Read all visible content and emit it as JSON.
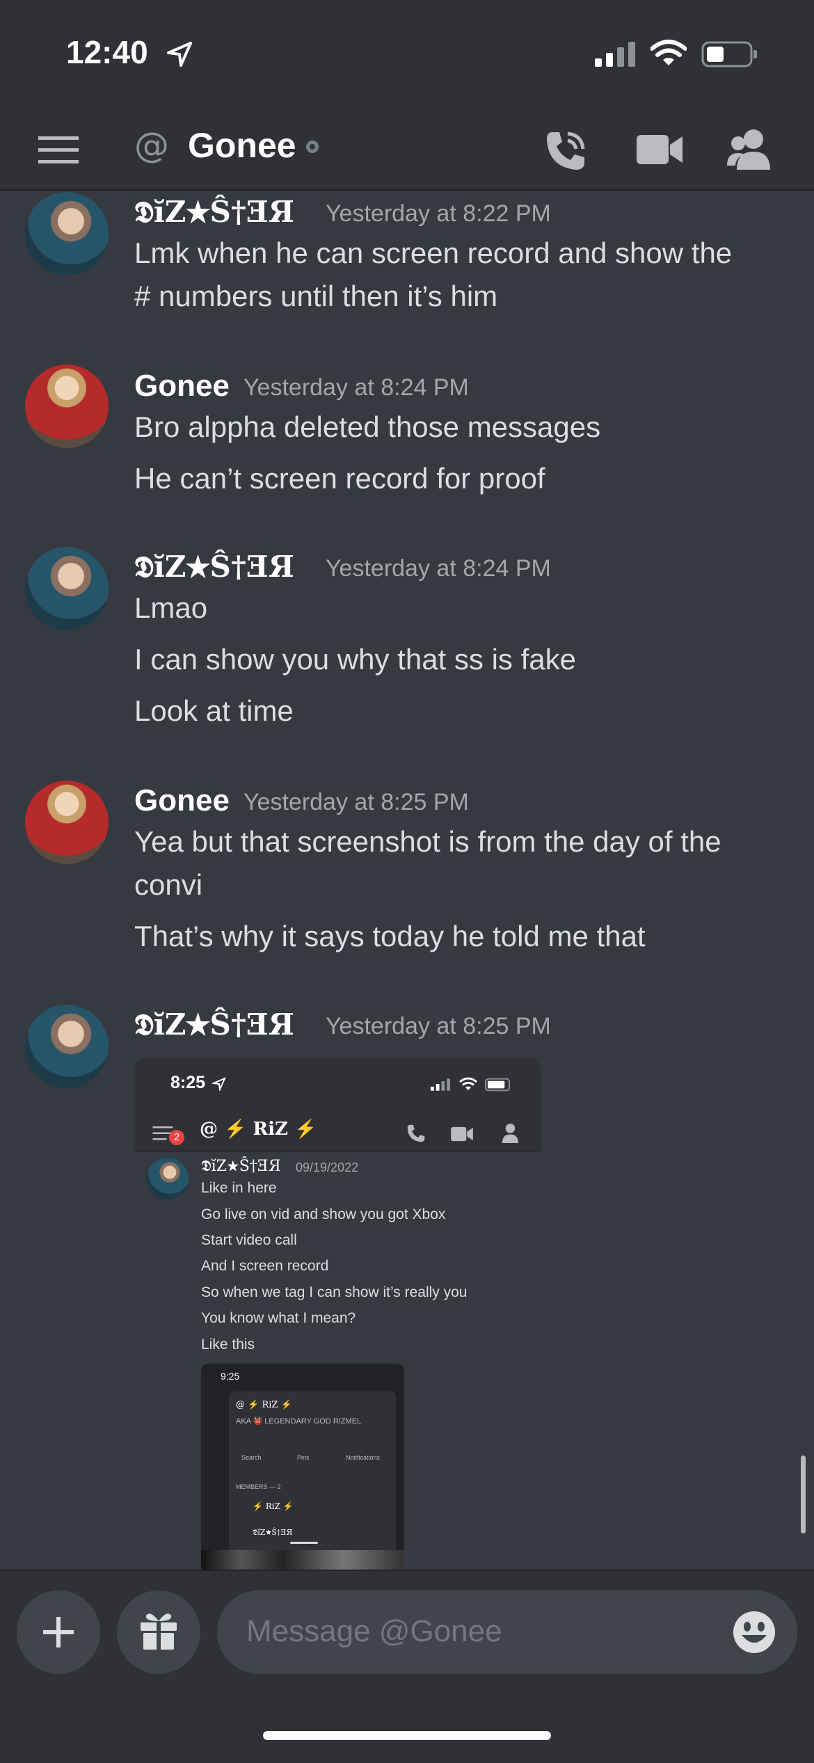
{
  "status_bar": {
    "time": "12:40"
  },
  "header": {
    "channel_prefix": "@",
    "channel_name": "Gonee"
  },
  "messages": [
    {
      "author": "𝕯ĭZ★Ŝ†ƎЯ",
      "timestamp": "Yesterday at 8:22 PM",
      "lines": [
        "Lmk when he can screen record and show the",
        "# numbers until then it’s him"
      ]
    },
    {
      "author": "Gonee",
      "timestamp": "Yesterday at 8:24 PM",
      "lines": [
        "Bro alppha deleted those messages",
        "He can’t screen record for proof"
      ]
    },
    {
      "author": "𝕯ĭZ★Ŝ†ƎЯ",
      "timestamp": "Yesterday at 8:24 PM",
      "lines": [
        "Lmao",
        "I can show you why that ss is fake",
        "Look at time"
      ]
    },
    {
      "author": "Gonee",
      "timestamp": "Yesterday at 8:25 PM",
      "lines": [
        "Yea but that screenshot is from the day of the",
        "convi",
        "That’s why it says today he told me that"
      ]
    },
    {
      "author": "𝕯ĭZ★Ŝ†ƎЯ",
      "timestamp": "Yesterday at 8:25 PM",
      "lines": []
    }
  ],
  "attachment": {
    "time": "8:25",
    "badge": "2",
    "channel": "@ ⚡ RiZ ⚡",
    "author": "𝕯ĭZ★Ŝ†ƎЯ",
    "date": "09/19/2022",
    "lines": [
      "Like in here",
      "Go live on vid and show you got Xbox",
      "Start video call",
      "And I screen record",
      "So when we tag I can show it’s really you",
      "You know what I mean?",
      "Like this"
    ],
    "inner": {
      "time": "9:25",
      "channel": "@ ⚡ RiZ ⚡",
      "aka": "AKA 👹 LEGENDARY GOD RIZMEL",
      "tabs": [
        "Search",
        "Pins",
        "Notifications"
      ],
      "members_label": "MEMBERS — 2",
      "members": [
        "⚡ RiZ ⚡",
        "𝕯ĭZ★Ŝ†ƎЯ"
      ]
    }
  },
  "composer": {
    "placeholder": "Message @Gonee"
  },
  "colors": {
    "background": "#36393f",
    "header": "#2f3136",
    "input": "#40444b",
    "muted": "#a3a6aa"
  }
}
